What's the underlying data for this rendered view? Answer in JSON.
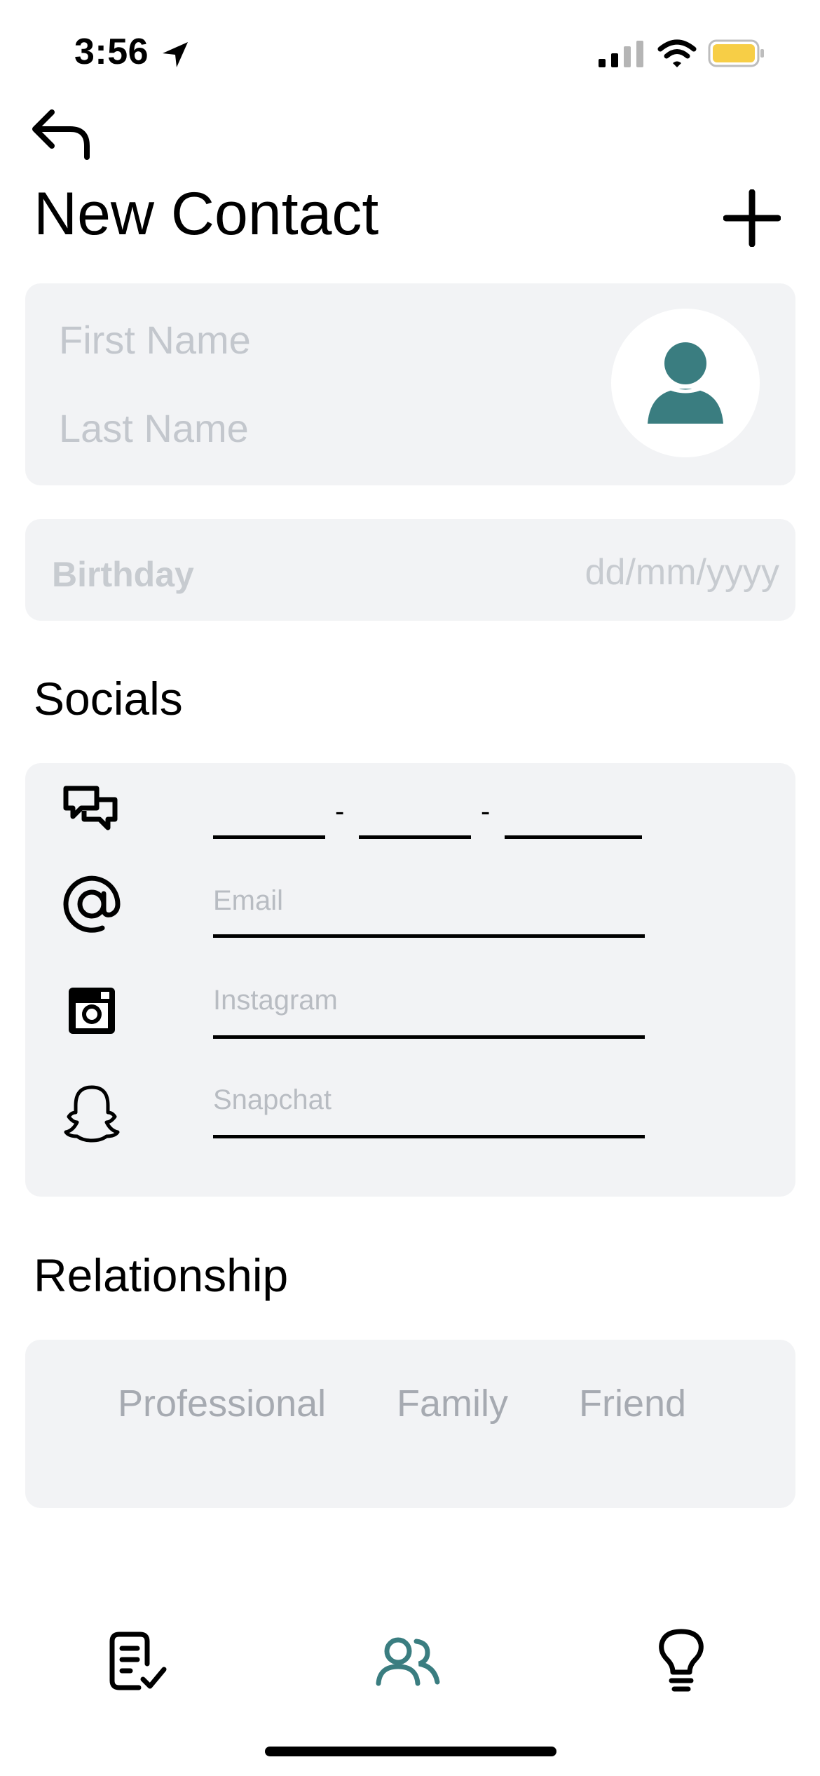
{
  "status_bar": {
    "time": "3:56"
  },
  "header": {
    "title": "New Contact"
  },
  "name_card": {
    "first_placeholder": "First Name",
    "last_placeholder": "Last Name"
  },
  "birthday": {
    "label": "Birthday",
    "placeholder": "dd/mm/yyyy"
  },
  "socials": {
    "heading": "Socials",
    "phone_separator": "-",
    "email_placeholder": "Email",
    "instagram_placeholder": "Instagram",
    "snapchat_placeholder": "Snapchat"
  },
  "relationship": {
    "heading": "Relationship",
    "options": [
      "Professional",
      "Family",
      "Friend"
    ]
  },
  "colors": {
    "accent": "#3a7d80",
    "card_bg": "#f2f3f5",
    "placeholder": "#c3c7cd",
    "battery": "#f7ce46"
  },
  "icons": {
    "back": "back-arrow-icon",
    "add": "plus-icon",
    "avatar": "person-icon",
    "phone": "chat-bubbles-icon",
    "email": "at-sign-icon",
    "instagram": "instagram-icon",
    "snapchat": "snapchat-ghost-icon",
    "tab_tasks": "checklist-icon",
    "tab_contacts": "people-icon",
    "tab_ideas": "lightbulb-icon"
  }
}
